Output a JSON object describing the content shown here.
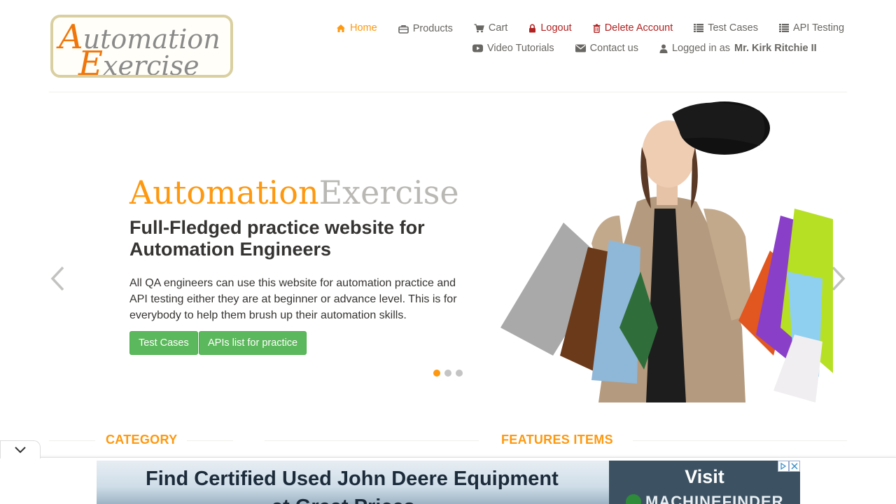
{
  "logo": {
    "line1_cap": "A",
    "line1_rest": "utomation",
    "line2_cap": "E",
    "line2_rest": "xercise"
  },
  "nav": {
    "home": "Home",
    "products": "Products",
    "cart": "Cart",
    "logout": "Logout",
    "delete_account": "Delete Account",
    "test_cases": "Test Cases",
    "api_testing": "API Testing",
    "video_tutorials": "Video Tutorials",
    "contact_us": "Contact us",
    "logged_in_prefix": "Logged in as",
    "user_name": "Mr. Kirk Ritchie II"
  },
  "hero": {
    "brand_part1": "Automation",
    "brand_part2": "Exercise",
    "title": "Full-Fledged practice website for Automation Engineers",
    "text": "All QA engineers can use this website for automation practice and API testing either they are at beginner or advance level. This is for everybody to help them brush up their automation skills.",
    "btn_test_cases": "Test Cases",
    "btn_apis": "APIs list for practice",
    "slides_total": 3,
    "active_slide": 1
  },
  "sections": {
    "category": "CATEGORY",
    "features": "FEATURES ITEMS"
  },
  "ad": {
    "headline": "Find Certified Used John Deere Equipment",
    "subline": "at Great Prices",
    "visit": "Visit",
    "brand": "MACHINEFINDER"
  },
  "colors": {
    "accent": "#fe980f",
    "danger": "#b22222",
    "button_green": "#5cb85c",
    "text": "#696763"
  }
}
